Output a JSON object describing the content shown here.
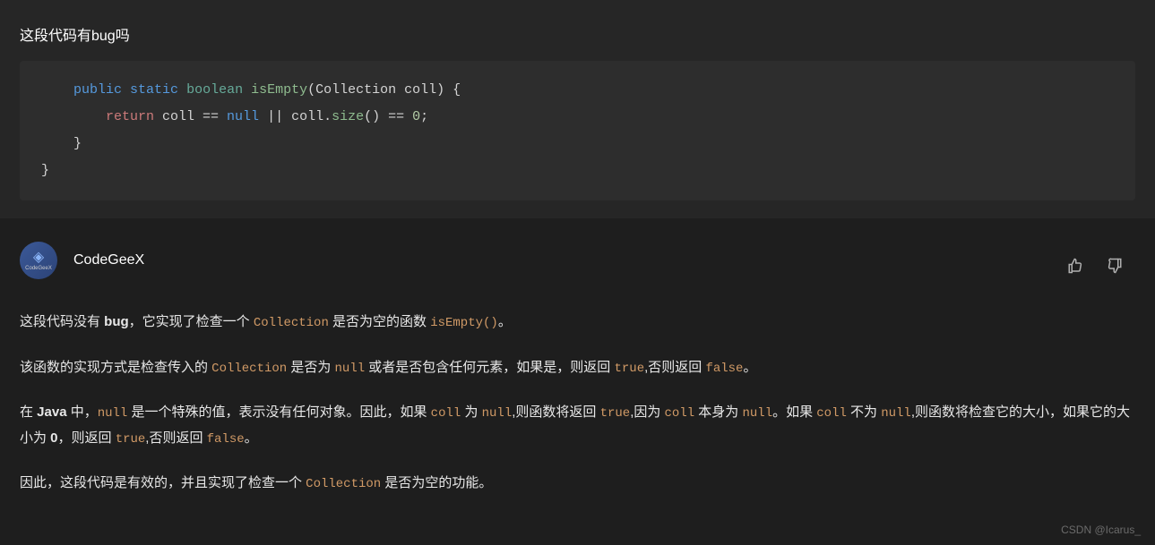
{
  "user": {
    "question": "这段代码有bug吗"
  },
  "code": {
    "line1": {
      "indent": "    ",
      "public": "public",
      "static": "static",
      "boolean": "boolean",
      "method": "isEmpty",
      "params": "(Collection coll) {"
    },
    "line2": {
      "indent": "        ",
      "return": "return",
      "expr1": " coll == ",
      "null": "null",
      "expr2": " || coll.",
      "size": "size",
      "expr3": "() == ",
      "zero": "0",
      "semi": ";"
    },
    "line3": "    }",
    "line4": "}"
  },
  "assistant": {
    "name": "CodeGeeX"
  },
  "response": {
    "p1": {
      "t1": "这段代码没有 ",
      "bold1": "bug",
      "t2": "，它实现了检查一个 ",
      "c1": "Collection",
      "t3": " 是否为空的函数 ",
      "c2": "isEmpty()",
      "t4": "。"
    },
    "p2": {
      "t1": "该函数的实现方式是检查传入的 ",
      "c1": "Collection",
      "t2": " 是否为 ",
      "c2": "null",
      "t3": " 或者是否包含任何元素，如果是，则返回 ",
      "c3": "true",
      "t4": ",否则返回 ",
      "c4": "false",
      "t5": "。"
    },
    "p3": {
      "t1": "在 ",
      "bold1": "Java",
      "t2": " 中，",
      "c1": "null",
      "t3": " 是一个特殊的值，表示没有任何对象。因此，如果 ",
      "c2": "coll",
      "t4": " 为 ",
      "c3": "null",
      "t5": ",则函数将返回 ",
      "c4": "true",
      "t6": ",因为 ",
      "c5": "coll",
      "t7": " 本身为 ",
      "c6": "null",
      "t8": "。如果 ",
      "c7": "coll",
      "t9": " 不为 ",
      "c8": "null",
      "t10": ",则函数将检查它的大小，如果它的大小为 ",
      "bold2": "0",
      "t11": "，则返回 ",
      "c9": "true",
      "t12": ",否则返回 ",
      "c10": "false",
      "t13": "。"
    },
    "p4": {
      "t1": "因此，这段代码是有效的，并且实现了检查一个 ",
      "c1": "Collection",
      "t2": " 是否为空的功能。"
    }
  },
  "watermark": "CSDN @Icarus_"
}
